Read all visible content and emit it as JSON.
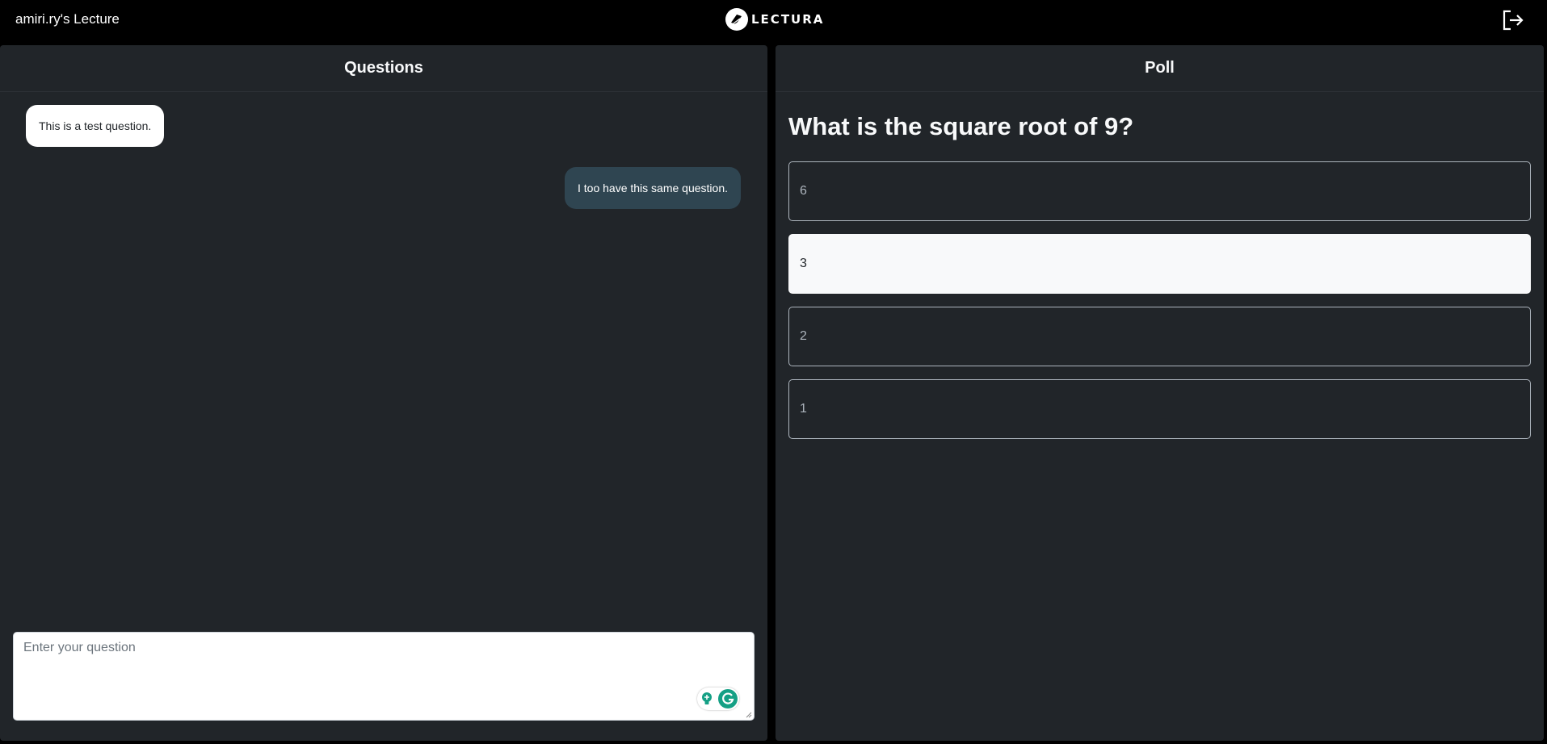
{
  "header": {
    "lecture_title": "amiri.ry's Lecture",
    "logo_text": "LECTURA"
  },
  "questions_panel": {
    "title": "Questions",
    "messages": [
      {
        "text": "This is a test question.",
        "side": "incoming"
      },
      {
        "text": "I too have this same question.",
        "side": "outgoing"
      }
    ],
    "input": {
      "placeholder": "Enter your question",
      "value": ""
    }
  },
  "poll_panel": {
    "title": "Poll",
    "question": "What is the square root of 9?",
    "options": [
      {
        "label": "6",
        "selected": false
      },
      {
        "label": "3",
        "selected": true
      },
      {
        "label": "2",
        "selected": false
      },
      {
        "label": "1",
        "selected": false
      }
    ]
  },
  "colors": {
    "page_bg": "#000000",
    "panel_bg": "#212529",
    "outgoing_bubble": "#2f4551",
    "grammarly_green": "#15a085"
  }
}
